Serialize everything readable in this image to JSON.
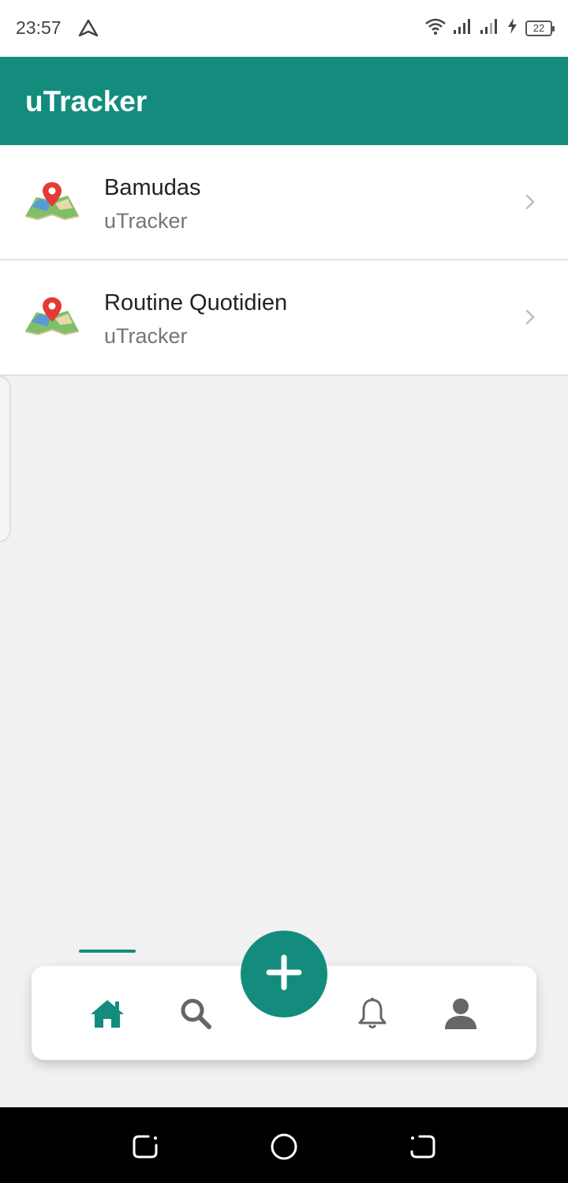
{
  "status_bar": {
    "time": "23:57",
    "battery_level": "22",
    "icons": [
      "navigation-arrow-icon",
      "wifi-icon",
      "signal-icon",
      "signal-icon",
      "charging-icon",
      "battery-icon"
    ]
  },
  "app_bar": {
    "title": "uTracker",
    "color": "#138c7e"
  },
  "list": {
    "items": [
      {
        "title": "Bamudas",
        "subtitle": "uTracker",
        "icon": "map-pin-icon"
      },
      {
        "title": "Routine Quotidien",
        "subtitle": "uTracker",
        "icon": "map-pin-icon"
      }
    ]
  },
  "bottom_nav": {
    "active_tab": "home",
    "items": [
      "home-icon",
      "search-icon",
      "add-icon",
      "bell-icon",
      "profile-icon"
    ]
  },
  "system_nav": {
    "items": [
      "recent-apps-icon",
      "home-circle-icon",
      "back-icon"
    ]
  }
}
